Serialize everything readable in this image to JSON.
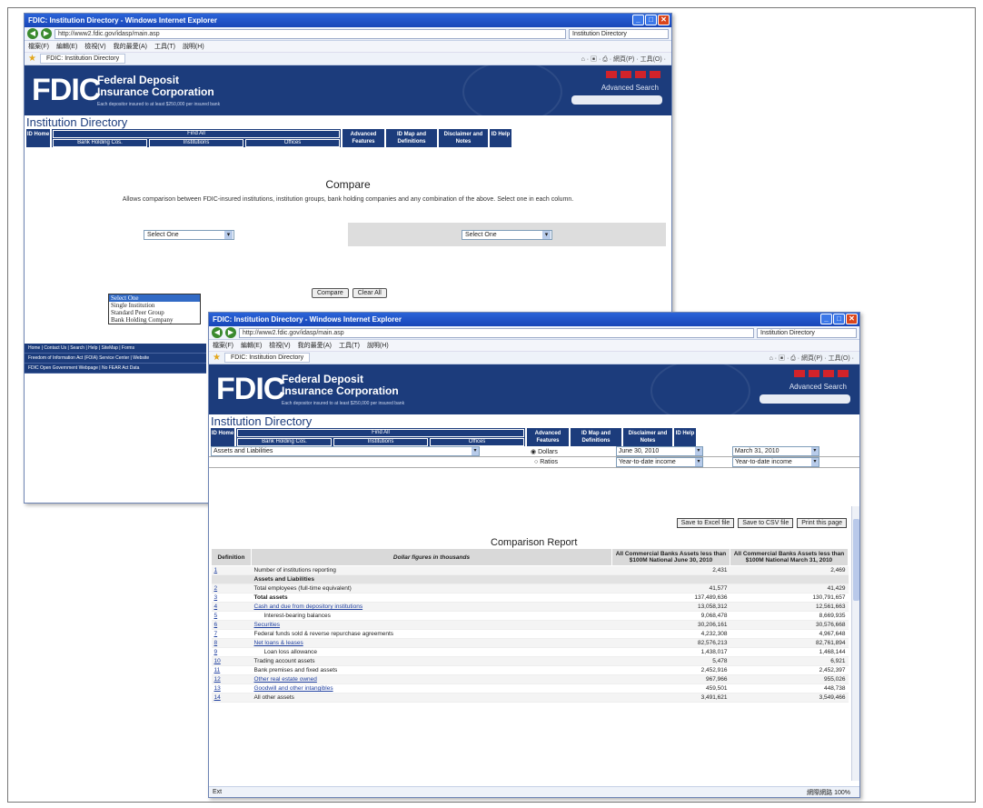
{
  "frame": {
    "label": "screenshot frame"
  },
  "w1": {
    "title": "FDIC: Institution Directory - Windows Internet Explorer",
    "url": "http://www2.fdic.gov/idasp/main.asp",
    "search": "Institution Directory",
    "menus": [
      "檔案(F)",
      "編輯(E)",
      "檢視(V)",
      "我的最愛(A)",
      "工具(T)",
      "說明(H)"
    ],
    "tab": "FDIC: Institution Directory",
    "tools": "⌂ · ▣ · ⎙ · 網頁(P) · 工具(O) ·",
    "org1": "Federal Deposit",
    "org2": "Insurance Corporation",
    "tag": "Each depositor insured to at least $250,000 per insured bank",
    "adv": "Advanced Search",
    "idir": "Institution Directory",
    "nav": {
      "home": "ID Home",
      "findall": "Find All",
      "bhc": "Bank Holding Cos.",
      "inst": "Institutions",
      "off": "Offices",
      "advf": "Advanced Features",
      "map": "ID Map and Definitions",
      "disc": "Disclaimer and Notes",
      "help": "ID Help"
    },
    "cmp_title": "Compare",
    "cmp_desc": "Allows comparison between FDIC-insured institutions, institution groups, bank holding companies and any combination of the above. Select one in each column.",
    "sel_left": "Select One",
    "sel_right": "Select One",
    "options": [
      "Select One",
      "Single Institution",
      "Standard Peer Group",
      "Bank Holding Company"
    ],
    "compare": "Compare",
    "clear": "Clear All",
    "footer": [
      "Home | Contact Us | Search | Help | SiteMap | Forms",
      "Freedom of Information Act (FOIA) Service Center | Website",
      "FDIC Open Government Webpage | No FEAR Act Data"
    ]
  },
  "w2": {
    "title": "FDIC: Institution Directory - Windows Internet Explorer",
    "filter": "Assets and Liabilities",
    "dollars": "Dollars",
    "ratios": "Ratios",
    "d1": "June 30, 2010",
    "d2": "March 31, 2010",
    "ytd1": "Year-to-date income",
    "ytd2": "Year-to-date income",
    "exp": [
      "Save to Excel file",
      "Save to CSV file",
      "Print this page"
    ],
    "report": "Comparison Report",
    "h_def": "Definition",
    "h_desc": "Dollar figures in thousands",
    "h_c1": "All Commercial Banks Assets less than $100M National June 30, 2010",
    "h_c2": "All Commercial Banks Assets less than $100M National March 31, 2010",
    "rows": [
      {
        "n": "1",
        "t": "Number of institutions reporting",
        "a": "2,431",
        "b": "2,469"
      },
      {
        "n": "",
        "t": "Assets and Liabilities",
        "a": "",
        "b": ""
      },
      {
        "n": "2",
        "t": "Total employees (full-time equivalent)",
        "a": "41,577",
        "b": "41,429"
      },
      {
        "n": "3",
        "t": "Total assets",
        "a": "137,489,636",
        "b": "130,791,657"
      },
      {
        "n": "4",
        "t": "Cash and due from depository institutions",
        "a": "13,058,312",
        "b": "12,561,663"
      },
      {
        "n": "5",
        "t": "Interest-bearing balances",
        "a": "9,068,478",
        "b": "8,669,935"
      },
      {
        "n": "6",
        "t": "Securities",
        "a": "30,206,161",
        "b": "30,576,668"
      },
      {
        "n": "7",
        "t": "Federal funds sold & reverse repurchase agreements",
        "a": "4,232,308",
        "b": "4,967,648"
      },
      {
        "n": "8",
        "t": "Net loans & leases",
        "a": "82,576,213",
        "b": "82,761,894"
      },
      {
        "n": "9",
        "t": "Loan loss allowance",
        "a": "1,438,017",
        "b": "1,468,144"
      },
      {
        "n": "10",
        "t": "Trading account assets",
        "a": "5,478",
        "b": "6,921"
      },
      {
        "n": "11",
        "t": "Bank premises and fixed assets",
        "a": "2,452,916",
        "b": "2,452,397"
      },
      {
        "n": "12",
        "t": "Other real estate owned",
        "a": "967,966",
        "b": "955,026"
      },
      {
        "n": "13",
        "t": "Goodwill and other intangibles",
        "a": "459,501",
        "b": "448,738"
      },
      {
        "n": "14",
        "t": "All other assets",
        "a": "3,491,621",
        "b": "3,549,466"
      }
    ],
    "status": "Ext",
    "status_r": "網際網路",
    "zoom": "100%"
  }
}
